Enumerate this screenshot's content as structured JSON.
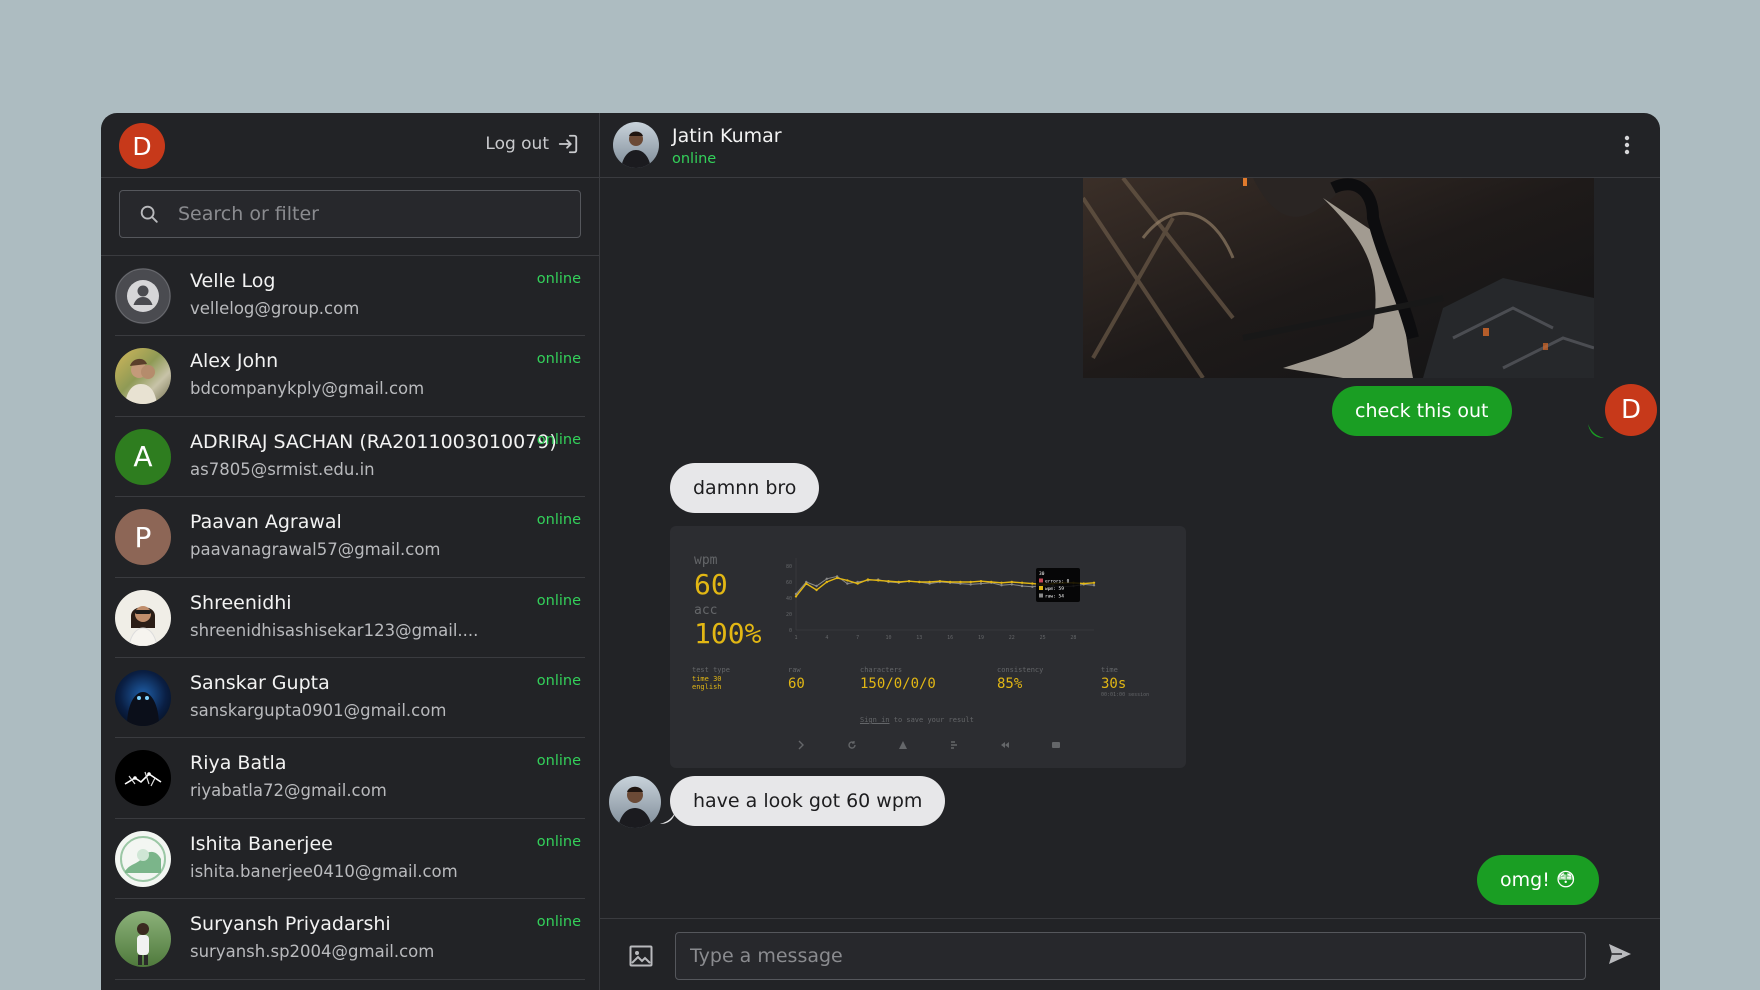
{
  "sidebar": {
    "me_initial": "D",
    "logout_label": "Log out",
    "search_placeholder": "Search or filter",
    "contacts": [
      {
        "name": "Velle Log",
        "email": "vellelog@group.com",
        "status": "online"
      },
      {
        "name": "Alex John",
        "email": "bdcompanykply@gmail.com",
        "status": "online"
      },
      {
        "name": "ADRIRAJ SACHAN (RA2011003010079)",
        "email": "as7805@srmist.edu.in",
        "status": "online",
        "initial": "A"
      },
      {
        "name": "Paavan Agrawal",
        "email": "paavanagrawal57@gmail.com",
        "status": "online",
        "initial": "P"
      },
      {
        "name": "Shreenidhi",
        "email": "shreenidhisashisekar123@gmail....",
        "status": "online"
      },
      {
        "name": "Sanskar Gupta",
        "email": "sanskargupta0901@gmail.com",
        "status": "online"
      },
      {
        "name": "Riya Batla",
        "email": "riyabatla72@gmail.com",
        "status": "online"
      },
      {
        "name": "Ishita Banerjee",
        "email": "ishita.banerjee0410@gmail.com",
        "status": "online"
      },
      {
        "name": "Suryansh Priyadarshi",
        "email": "suryansh.sp2004@gmail.com",
        "status": "online"
      }
    ]
  },
  "chat": {
    "peer_name": "Jatin Kumar",
    "peer_status": "online",
    "me_initial": "D",
    "messages": {
      "m1": "check this out",
      "m2": "damnn bro",
      "m3": "have a look got 60 wpm",
      "m4": "omg! 😳"
    },
    "typing_result": {
      "wpm_label": "wpm",
      "wpm": "60",
      "acc_label": "acc",
      "acc": "100%",
      "test_type_label": "test type",
      "test_type": "time 30",
      "language": "english",
      "raw_label": "raw",
      "raw": "60",
      "characters_label": "characters",
      "characters": "150/0/0/0",
      "consistency_label": "consistency",
      "consistency": "85%",
      "time_label": "time",
      "time": "30s",
      "session": "00:01:00 session",
      "tooltip_title": "30",
      "tooltip_errors": "errors: 0",
      "tooltip_wpm": "wpm: 59",
      "tooltip_raw": "raw: 54",
      "sign_in": "Sign in",
      "save_text": " to save your result",
      "chart_data": {
        "type": "line",
        "x": [
          1,
          2,
          3,
          4,
          5,
          6,
          7,
          8,
          9,
          10,
          11,
          12,
          13,
          14,
          15,
          16,
          17,
          18,
          19,
          20,
          21,
          22,
          23,
          24,
          25,
          26,
          27,
          28,
          29,
          30
        ],
        "x_ticks": [
          "1",
          "4",
          "7",
          "10",
          "13",
          "16",
          "19",
          "22",
          "25",
          "28"
        ],
        "y_ticks": [
          "80",
          "60",
          "40",
          "20",
          "0"
        ],
        "ylim": [
          0,
          90
        ],
        "series": [
          {
            "name": "wpm",
            "color": "#e2b714",
            "values": [
              42,
              58,
              50,
              60,
              65,
              62,
              58,
              63,
              62,
              61,
              60,
              61,
              60,
              60,
              61,
              60,
              60,
              60,
              61,
              60,
              59,
              60,
              59,
              58,
              57,
              58,
              59,
              59,
              58,
              59
            ]
          },
          {
            "name": "raw",
            "color": "#8a8a8a",
            "values": [
              45,
              60,
              55,
              64,
              67,
              58,
              60,
              62,
              63,
              60,
              59,
              61,
              60,
              58,
              60,
              59,
              58,
              57,
              58,
              59,
              56,
              57,
              55,
              54,
              56,
              55,
              54,
              55,
              57,
              56
            ]
          }
        ]
      }
    },
    "composer_placeholder": "Type a message"
  }
}
